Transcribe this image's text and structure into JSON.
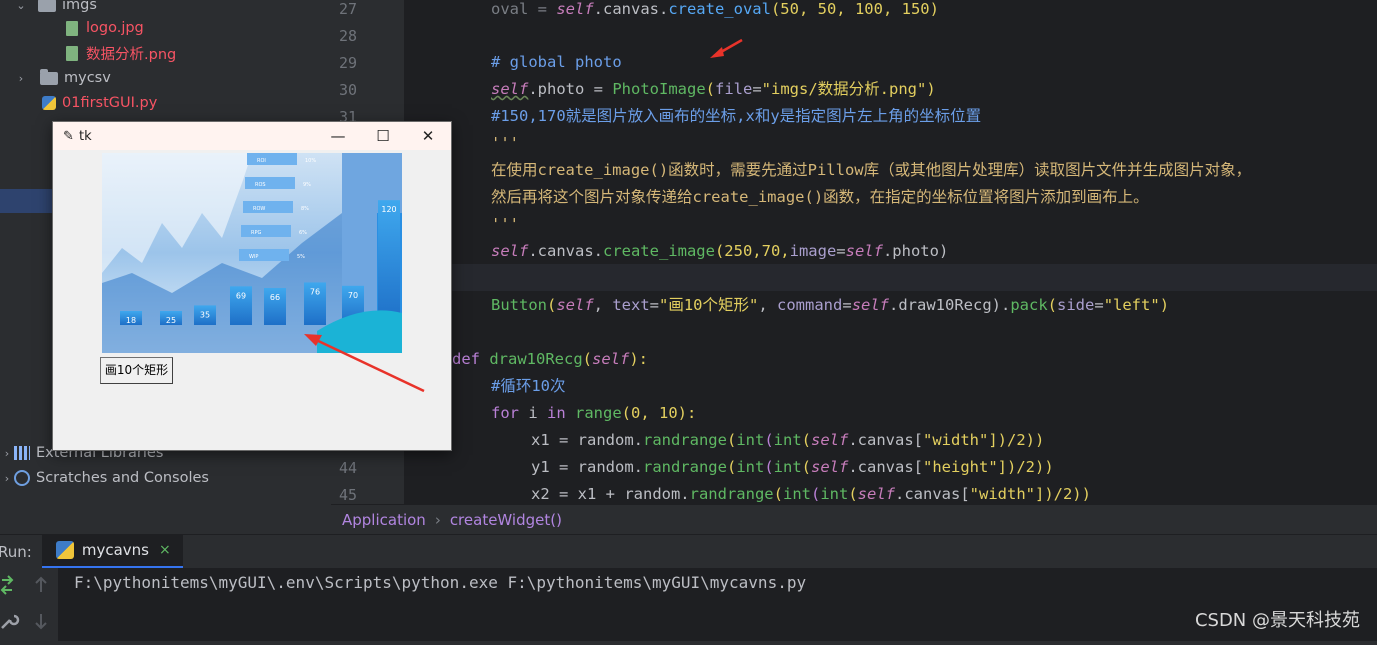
{
  "project_tree": {
    "items": [
      {
        "label": "imgs",
        "type": "folder",
        "color": "#bcbec4"
      },
      {
        "label": "logo.jpg",
        "type": "file",
        "color": "#f75464"
      },
      {
        "label": "数据分析.png",
        "type": "file",
        "color": "#f75464"
      },
      {
        "label": "mycsv",
        "type": "folder",
        "color": "#bcbec4"
      },
      {
        "label": "01firstGUI.py",
        "type": "python",
        "color": "#f75464"
      },
      {
        "label": "External Libraries",
        "type": "library",
        "color": "#bcbec4"
      },
      {
        "label": "Scratches and Consoles",
        "type": "scratch",
        "color": "#bcbec4"
      }
    ]
  },
  "editor": {
    "line_numbers": [
      "27",
      "28",
      "29",
      "30",
      "31",
      "44",
      "45"
    ],
    "code": {
      "l27a": "oval = ",
      "l27b": "self",
      "l27c": ".canvas.",
      "l27d": "create_oval",
      "l27e": "(50, 50, 100, 150)",
      "l29": "# global photo",
      "l30a": "self",
      "l30b": ".photo = ",
      "l30c": "PhotoImage",
      "l30d": "(",
      "l30e": "file",
      "l30f": "=",
      "l30g": "\"imgs/数据分析.png\"",
      "l30h": ")",
      "l31": "#150,170就是图片放入画布的坐标,x和y是指定图片左上角的坐标位置",
      "doc1": "'''",
      "doc2": "在使用create_image()函数时，需要先通过Pillow库（或其他图片处理库）读取图片文件并生成图片对象，",
      "doc3": "然后再将这个图片对象传递给create_image()函数，在指定的坐标位置将图片添加到画布上。",
      "doc4": "'''",
      "ci_a": "self",
      "ci_b": ".canvas.",
      "ci_c": "create_image",
      "ci_d": "(250,70,",
      "ci_e": "image",
      "ci_f": "=",
      "ci_g": "self",
      "ci_h": ".photo)",
      "btn_a": "Button",
      "btn_b": "(",
      "btn_c": "self",
      "btn_d": ", ",
      "btn_e": "text",
      "btn_f": "=",
      "btn_g": "\"画10个矩形\"",
      "btn_h": ", ",
      "btn_i": "command",
      "btn_j": "=",
      "btn_k": "self",
      "btn_l": ".draw10Recg).",
      "btn_m": "pack",
      "btn_n": "(",
      "btn_o": "side",
      "btn_p": "=",
      "btn_q": "\"left\"",
      "btn_r": ")",
      "def_a": "def ",
      "def_b": "draw10Recg",
      "def_c": "(",
      "def_d": "self",
      "def_e": "):",
      "loop_cmt": "#循环10次",
      "for_a": "for ",
      "for_b": "i ",
      "for_c": "in ",
      "for_d": "range",
      "for_e": "(0, 10):",
      "x1_a": "x1 = random.",
      "x1_b": "randrange",
      "x1_c": "(",
      "x1_d": "int",
      "x1_e": "(",
      "x1_f": "int",
      "x1_g": "(",
      "x1_h": "self",
      "x1_i": ".canvas[",
      "x1_j": "\"width\"",
      "x1_k": "])/2))",
      "y1_a": "y1 = random.",
      "y1_b": "randrange",
      "y1_c": "(",
      "y1_d": "int",
      "y1_e": "(",
      "y1_f": "int",
      "y1_g": "(",
      "y1_h": "self",
      "y1_i": ".canvas[",
      "y1_j": "\"height\"",
      "y1_k": "])/2))",
      "x2_a": "x2 = x1 + random.",
      "x2_b": "randrange",
      "x2_c": "(",
      "x2_d": "int",
      "x2_e": "(",
      "x2_f": "int",
      "x2_g": "(",
      "x2_h": "self",
      "x2_i": ".canvas[",
      "x2_j": "\"width\"",
      "x2_k": "])/2))"
    }
  },
  "breadcrumb": {
    "items": [
      "Application",
      "createWidget()"
    ],
    "separator": "›"
  },
  "run_panel": {
    "label": "Run:",
    "tab_label": "mycavns",
    "tab_close": "×",
    "console_line": "F:\\pythonitems\\myGUI\\.env\\Scripts\\python.exe F:\\pythonitems\\myGUI\\mycavns.py"
  },
  "tk_window": {
    "title": "tk",
    "minimize": "—",
    "maximize": "☐",
    "close": "✕",
    "button_label": "画10个矩形",
    "bar_values": [
      18,
      25,
      35,
      69,
      66,
      76,
      70,
      120
    ],
    "tab_labels": [
      "ROI",
      "ROS",
      "ROW",
      "RPG",
      "WIP"
    ],
    "tab_percents": [
      "10%",
      "9%",
      "8%",
      "6%",
      "5%"
    ]
  },
  "watermark": "CSDN @景天科技苑",
  "colors": {
    "accent": "#3574f0",
    "annotation_arrow": "#e8332a"
  }
}
